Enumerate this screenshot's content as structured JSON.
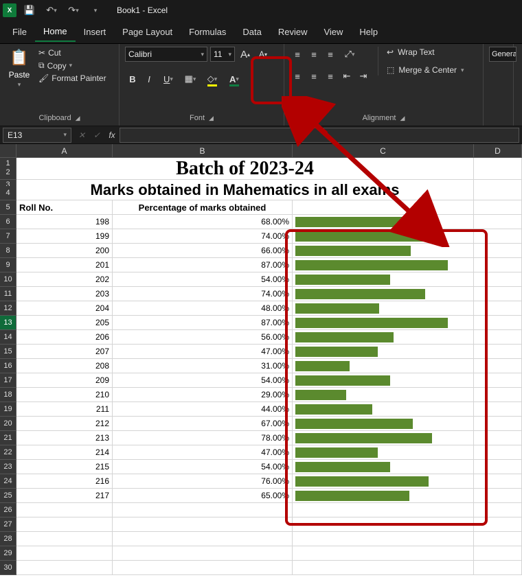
{
  "titlebar": {
    "title": "Book1 - Excel",
    "app_letter": "X"
  },
  "menu": {
    "tabs": [
      "File",
      "Home",
      "Insert",
      "Page Layout",
      "Formulas",
      "Data",
      "Review",
      "View",
      "Help"
    ],
    "active": "Home"
  },
  "ribbon": {
    "clipboard": {
      "paste": "Paste",
      "cut": "Cut",
      "copy": "Copy",
      "painter": "Format Painter",
      "label": "Clipboard"
    },
    "font": {
      "name": "Calibri",
      "size": "11",
      "label": "Font"
    },
    "alignment": {
      "wrap": "Wrap Text",
      "merge": "Merge & Center",
      "label": "Alignment"
    },
    "number": {
      "format": "General"
    }
  },
  "namebox": "E13",
  "sheet": {
    "title": "Batch of 2023-24",
    "subtitle": "Marks obtained in Mahematics in all exams",
    "headers": {
      "a": "Roll No.",
      "b": "Percentage of marks obtained"
    },
    "rows": [
      {
        "roll": 198,
        "pct": "68.00%",
        "bar": 68
      },
      {
        "roll": 199,
        "pct": "74.00%",
        "bar": 74
      },
      {
        "roll": 200,
        "pct": "66.00%",
        "bar": 66
      },
      {
        "roll": 201,
        "pct": "87.00%",
        "bar": 87
      },
      {
        "roll": 202,
        "pct": "54.00%",
        "bar": 54
      },
      {
        "roll": 203,
        "pct": "74.00%",
        "bar": 74
      },
      {
        "roll": 204,
        "pct": "48.00%",
        "bar": 48
      },
      {
        "roll": 205,
        "pct": "87.00%",
        "bar": 87
      },
      {
        "roll": 206,
        "pct": "56.00%",
        "bar": 56
      },
      {
        "roll": 207,
        "pct": "47.00%",
        "bar": 47
      },
      {
        "roll": 208,
        "pct": "31.00%",
        "bar": 31
      },
      {
        "roll": 209,
        "pct": "54.00%",
        "bar": 54
      },
      {
        "roll": 210,
        "pct": "29.00%",
        "bar": 29
      },
      {
        "roll": 211,
        "pct": "44.00%",
        "bar": 44
      },
      {
        "roll": 212,
        "pct": "67.00%",
        "bar": 67
      },
      {
        "roll": 213,
        "pct": "78.00%",
        "bar": 78
      },
      {
        "roll": 214,
        "pct": "47.00%",
        "bar": 47
      },
      {
        "roll": 215,
        "pct": "54.00%",
        "bar": 54
      },
      {
        "roll": 216,
        "pct": "76.00%",
        "bar": 76
      },
      {
        "roll": 217,
        "pct": "65.00%",
        "bar": 65
      }
    ]
  },
  "chart_data": {
    "type": "bar",
    "title": "Batch of 2023-24 — Marks obtained in Mahematics in all exams",
    "xlabel": "Roll No.",
    "ylabel": "Percentage of marks obtained",
    "ylim": [
      0,
      100
    ],
    "categories": [
      198,
      199,
      200,
      201,
      202,
      203,
      204,
      205,
      206,
      207,
      208,
      209,
      210,
      211,
      212,
      213,
      214,
      215,
      216,
      217
    ],
    "values": [
      68,
      74,
      66,
      87,
      54,
      74,
      48,
      87,
      56,
      47,
      31,
      54,
      29,
      44,
      67,
      78,
      47,
      54,
      76,
      65
    ]
  }
}
